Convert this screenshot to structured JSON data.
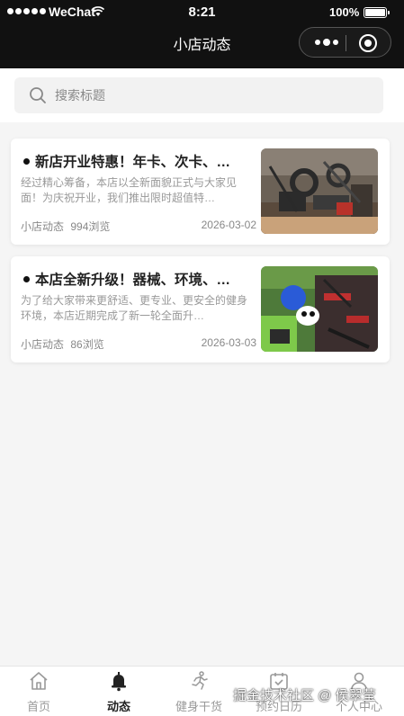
{
  "status_bar": {
    "carrier": "WeChat",
    "time": "8:21",
    "battery": "100%"
  },
  "nav": {
    "title": "小店动态"
  },
  "search": {
    "placeholder": "搜索标题"
  },
  "articles": [
    {
      "title": "新店开业特惠！年卡、次卡、…",
      "summary": "经过精心筹备，本店以全新面貌正式与大家见面！为庆祝开业，我们推出限时超值特…",
      "category": "小店动态",
      "views": "994浏览",
      "date": "2026-03-02",
      "image": "gym-equipment-photo"
    },
    {
      "title": "本店全新升级！器械、环境、…",
      "summary": "为了给大家带来更舒适、更专业、更安全的健身环境，本店近期完成了新一轮全面升…",
      "category": "小店动态",
      "views": "86浏览",
      "date": "2026-03-03",
      "image": "gym-upgrade-photo"
    }
  ],
  "tabbar": {
    "items": [
      {
        "label": "首页",
        "icon": "home-icon",
        "active": false
      },
      {
        "label": "动态",
        "icon": "bell-icon",
        "active": true
      },
      {
        "label": "健身干货",
        "icon": "running-icon",
        "active": false
      },
      {
        "label": "预约日历",
        "icon": "calendar-icon",
        "active": false
      },
      {
        "label": "个人中心",
        "icon": "user-icon",
        "active": false
      }
    ]
  },
  "watermark": "掘金技术社区 @ 侯翠莹",
  "colors": {
    "header_bg": "#111111",
    "page_bg": "#f5f5f5",
    "muted_text": "#999999"
  }
}
